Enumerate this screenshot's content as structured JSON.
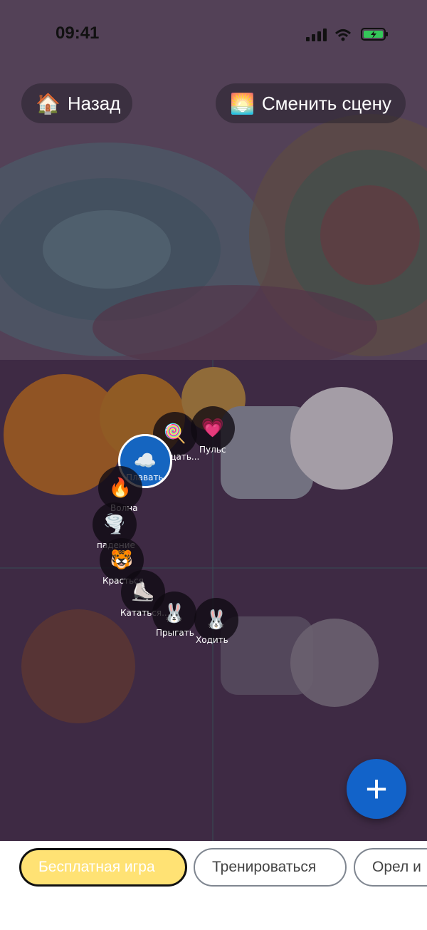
{
  "status": {
    "time": "09:41",
    "icons": [
      "signal-icon",
      "wifi-icon",
      "battery-icon"
    ]
  },
  "header": {
    "back": {
      "icon": "🏠",
      "label": "Назад"
    },
    "scene": {
      "icon": "🌅",
      "label": "Сменить сцену"
    }
  },
  "actions": [
    {
      "icon": "🍭",
      "label": "Вращать..."
    },
    {
      "icon": "💗",
      "label": "Пульс"
    },
    {
      "icon": "☁️",
      "label": "Плавать"
    },
    {
      "icon": "🔥",
      "label": "Волна"
    },
    {
      "icon": "🌪️",
      "label": "падение"
    },
    {
      "icon": "🐯",
      "label": "Красться"
    },
    {
      "icon": "⛸️",
      "label": "Кататься..."
    },
    {
      "icon": "🐰",
      "label": "Прыгать"
    },
    {
      "icon": "🐰",
      "label": "Ходить"
    }
  ],
  "fab": {
    "label": "+"
  },
  "tabs": [
    "Бесплатная игра",
    "Тренироваться",
    "Орел и"
  ],
  "colors": {
    "accent": "#1263c9",
    "selected_tab": "#ffe274"
  }
}
